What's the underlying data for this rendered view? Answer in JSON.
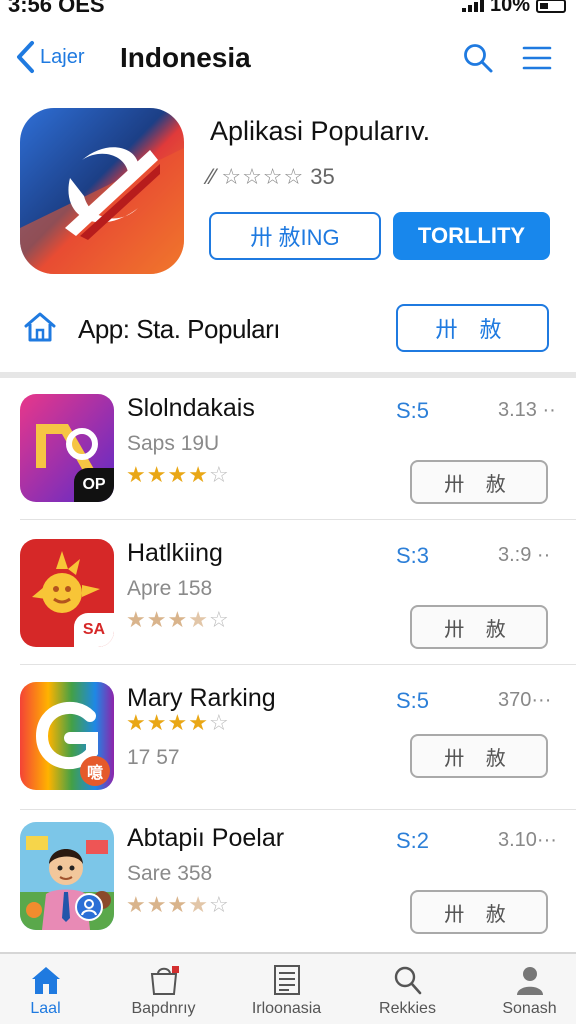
{
  "status": {
    "time": "3:56 OES",
    "battery": "10%"
  },
  "nav": {
    "back_label": "Lajer",
    "title": "Indonesia"
  },
  "hero": {
    "title": "Aplikasi Popularıv.",
    "rating_prefix": "⁄⁄",
    "rating_count": "35",
    "btn_secondary": "卅 赦ING",
    "btn_primary": "TORLLITY"
  },
  "section": {
    "title": "App: Sta. Popuları",
    "button": "卅 赦"
  },
  "apps": [
    {
      "name": "Slolndakais",
      "sub": "Saps 19U",
      "stars": 4,
      "price": "S:5",
      "size": "3.13 ··",
      "button": "卅 赦",
      "badge": "OP"
    },
    {
      "name": "Hatlkiing",
      "sub": "Apre 158",
      "stars": 3.5,
      "price": "S:3",
      "size": "3.:9 ··",
      "button": "卅 赦",
      "badge": "SA"
    },
    {
      "name": "Mary Rarking",
      "sub": "17 57",
      "stars": 4,
      "price": "S:5",
      "size": "370···",
      "button": "卅 赦",
      "badge": "噫"
    },
    {
      "name": "Abtapiı Poelar",
      "sub": "Sare 358",
      "stars": 3.5,
      "price": "S:2",
      "size": "3.10···",
      "button": "卅 赦",
      "badge": ""
    }
  ],
  "tabs": [
    {
      "label": "Laal",
      "icon": "home-icon",
      "active": true
    },
    {
      "label": "Bapdnrıy",
      "icon": "store-icon",
      "active": false
    },
    {
      "label": "Irloonasia",
      "icon": "list-icon",
      "active": false
    },
    {
      "label": "Rekkies",
      "icon": "search-icon",
      "active": false
    },
    {
      "label": "Sonash",
      "icon": "person-icon",
      "active": false
    }
  ],
  "colors": {
    "accent": "#1f7ae0",
    "primary_button": "#1887ec",
    "star_gold": "#e9a716",
    "star_pale": "#d9b48c"
  }
}
